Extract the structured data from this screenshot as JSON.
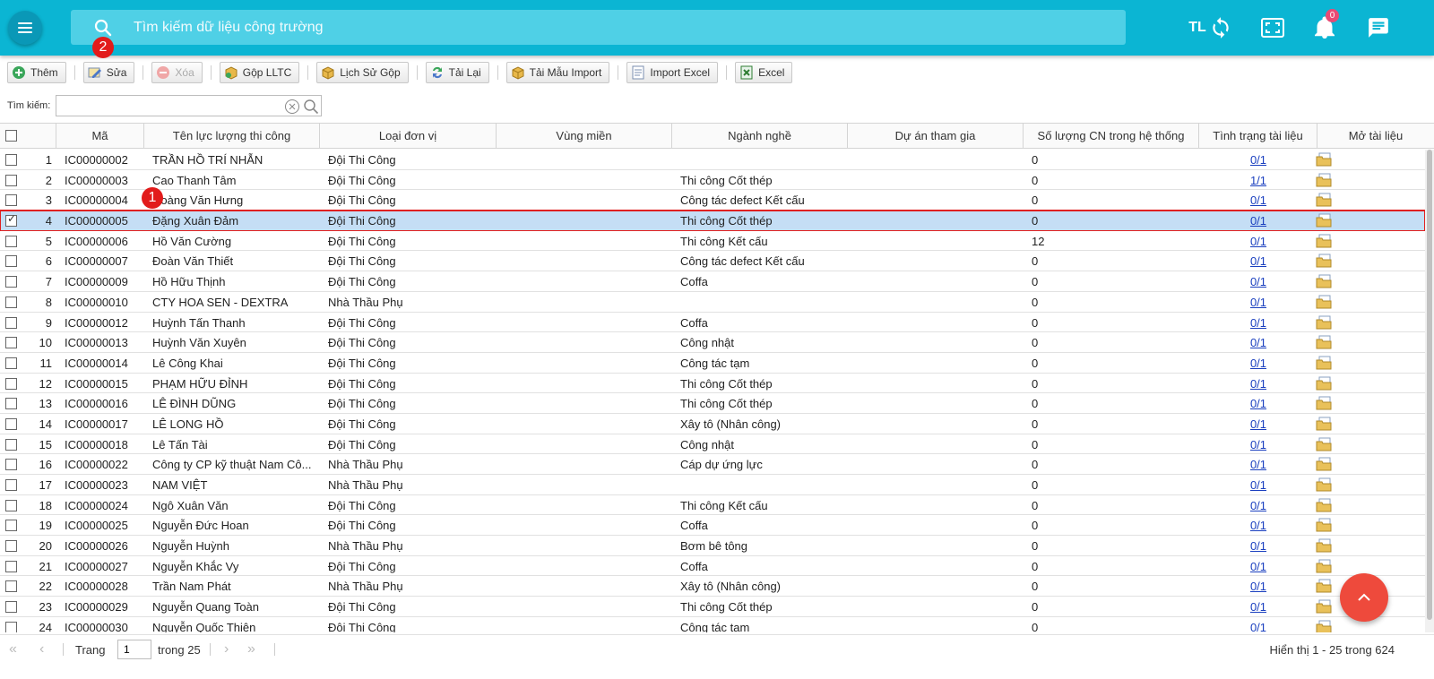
{
  "header": {
    "search_placeholder": "Tìm kiếm dữ liệu công trường",
    "user_initials": "TL",
    "notification_count": "0"
  },
  "toolbar": {
    "add": "Thêm",
    "edit": "Sửa",
    "delete": "Xóa",
    "merge": "Gộp LLTC",
    "merge_history": "Lịch Sử Gộp",
    "reload": "Tải Lại",
    "download_template": "Tải Mẫu Import",
    "import_excel": "Import Excel",
    "excel": "Excel"
  },
  "filter": {
    "label": "Tìm kiếm:",
    "value": ""
  },
  "grid": {
    "columns": [
      "Mã",
      "Tên lực lượng thi công",
      "Loại đơn vị",
      "Vùng miền",
      "Ngành nghề",
      "Dự án tham gia",
      "Số lượng CN trong hệ thống",
      "Tình trạng tài liệu",
      "Mở tài liệu"
    ],
    "rows": [
      {
        "n": "1",
        "code": "IC00000002",
        "name": "TRẦN HỒ TRÍ NHẪN",
        "unit": "Đội Thi Công",
        "region": "",
        "trade": "",
        "project": "",
        "qty": "0",
        "doc": "0/1"
      },
      {
        "n": "2",
        "code": "IC00000003",
        "name": "Cao Thanh Tâm",
        "unit": "Đội Thi Công",
        "region": "",
        "trade": "Thi công Cốt thép",
        "project": "",
        "qty": "0",
        "doc": "1/1"
      },
      {
        "n": "3",
        "code": "IC00000004",
        "name": "Hoàng Văn Hưng",
        "unit": "Đội Thi Công",
        "region": "",
        "trade": "Công tác defect Kết cấu",
        "project": "",
        "qty": "0",
        "doc": "0/1"
      },
      {
        "n": "4",
        "code": "IC00000005",
        "name": "Đặng Xuân Đảm",
        "unit": "Đội Thi Công",
        "region": "",
        "trade": "Thi công Cốt thép",
        "project": "",
        "qty": "0",
        "doc": "0/1"
      },
      {
        "n": "5",
        "code": "IC00000006",
        "name": "Hồ Văn Cường",
        "unit": "Đội Thi Công",
        "region": "",
        "trade": "Thi công Kết cấu",
        "project": "",
        "qty": "12",
        "doc": "0/1"
      },
      {
        "n": "6",
        "code": "IC00000007",
        "name": "Đoàn Văn Thiết",
        "unit": "Đội Thi Công",
        "region": "",
        "trade": "Công tác defect Kết cấu",
        "project": "",
        "qty": "0",
        "doc": "0/1"
      },
      {
        "n": "7",
        "code": "IC00000009",
        "name": "Hồ Hữu Thịnh",
        "unit": "Đội Thi Công",
        "region": "",
        "trade": "Coffa",
        "project": "",
        "qty": "0",
        "doc": "0/1"
      },
      {
        "n": "8",
        "code": "IC00000010",
        "name": "CTY HOA SEN - DEXTRA",
        "unit": "Nhà Thầu Phụ",
        "region": "",
        "trade": "",
        "project": "",
        "qty": "0",
        "doc": "0/1"
      },
      {
        "n": "9",
        "code": "IC00000012",
        "name": "Huỳnh Tấn Thanh",
        "unit": "Đội Thi Công",
        "region": "",
        "trade": "Coffa",
        "project": "",
        "qty": "0",
        "doc": "0/1"
      },
      {
        "n": "10",
        "code": "IC00000013",
        "name": "Huỳnh Văn Xuyên",
        "unit": "Đội Thi Công",
        "region": "",
        "trade": "Công nhật",
        "project": "",
        "qty": "0",
        "doc": "0/1"
      },
      {
        "n": "11",
        "code": "IC00000014",
        "name": "Lê Công Khai",
        "unit": "Đội Thi Công",
        "region": "",
        "trade": "Công tác tạm",
        "project": "",
        "qty": "0",
        "doc": "0/1"
      },
      {
        "n": "12",
        "code": "IC00000015",
        "name": "PHẠM HỮU ĐỈNH",
        "unit": "Đội Thi Công",
        "region": "",
        "trade": "Thi công Cốt thép",
        "project": "",
        "qty": "0",
        "doc": "0/1"
      },
      {
        "n": "13",
        "code": "IC00000016",
        "name": "LÊ ĐÌNH DŨNG",
        "unit": "Đội Thi Công",
        "region": "",
        "trade": "Thi công Cốt thép",
        "project": "",
        "qty": "0",
        "doc": "0/1"
      },
      {
        "n": "14",
        "code": "IC00000017",
        "name": "LÊ LONG HỒ",
        "unit": "Đội Thi Công",
        "region": "",
        "trade": "Xây tô (Nhân công)",
        "project": "",
        "qty": "0",
        "doc": "0/1"
      },
      {
        "n": "15",
        "code": "IC00000018",
        "name": "Lê Tấn Tài",
        "unit": "Đội Thi Công",
        "region": "",
        "trade": "Công nhật",
        "project": "",
        "qty": "0",
        "doc": "0/1"
      },
      {
        "n": "16",
        "code": "IC00000022",
        "name": "Công ty CP kỹ thuật Nam Cô...",
        "unit": "Nhà Thầu Phụ",
        "region": "",
        "trade": "Cáp dự ứng lực",
        "project": "",
        "qty": "0",
        "doc": "0/1"
      },
      {
        "n": "17",
        "code": "IC00000023",
        "name": "NAM VIỆT",
        "unit": "Nhà Thầu Phụ",
        "region": "",
        "trade": "",
        "project": "",
        "qty": "0",
        "doc": "0/1"
      },
      {
        "n": "18",
        "code": "IC00000024",
        "name": "Ngô Xuân Văn",
        "unit": "Đội Thi Công",
        "region": "",
        "trade": "Thi công Kết cấu",
        "project": "",
        "qty": "0",
        "doc": "0/1"
      },
      {
        "n": "19",
        "code": "IC00000025",
        "name": "Nguyễn Đức Hoan",
        "unit": "Đội Thi Công",
        "region": "",
        "trade": "Coffa",
        "project": "",
        "qty": "0",
        "doc": "0/1"
      },
      {
        "n": "20",
        "code": "IC00000026",
        "name": "Nguyễn Huỳnh",
        "unit": "Nhà Thầu Phụ",
        "region": "",
        "trade": "Bơm bê tông",
        "project": "",
        "qty": "0",
        "doc": "0/1"
      },
      {
        "n": "21",
        "code": "IC00000027",
        "name": "Nguyễn Khắc Vy",
        "unit": "Đội Thi Công",
        "region": "",
        "trade": "Coffa",
        "project": "",
        "qty": "0",
        "doc": "0/1"
      },
      {
        "n": "22",
        "code": "IC00000028",
        "name": "Trần Nam Phát",
        "unit": "Nhà Thầu Phụ",
        "region": "",
        "trade": "Xây tô (Nhân công)",
        "project": "",
        "qty": "0",
        "doc": "0/1"
      },
      {
        "n": "23",
        "code": "IC00000029",
        "name": "Nguyễn Quang Toàn",
        "unit": "Đội Thi Công",
        "region": "",
        "trade": "Thi công Cốt thép",
        "project": "",
        "qty": "0",
        "doc": "0/1"
      },
      {
        "n": "24",
        "code": "IC00000030",
        "name": "Nguyễn Quốc Thiện",
        "unit": "Đội Thi Công",
        "region": "",
        "trade": "Công tác tạm",
        "project": "",
        "qty": "0",
        "doc": "0/1"
      }
    ],
    "selected_row": 3
  },
  "pager": {
    "page_label": "Trang",
    "page_value": "1",
    "of_label": "trong 25",
    "summary": "Hiển thị 1 - 25 trong 624"
  },
  "markers": {
    "first": "1",
    "second": "2"
  },
  "colors": {
    "header": "#0bb5d3",
    "selection": "#c5def5",
    "highlight": "#e02020",
    "fab": "#ee4a3c"
  },
  "icons": {
    "menu": "hamburger-icon",
    "search": "search-icon",
    "sync": "sync-icon",
    "fullscreen": "fullscreen-icon",
    "bell": "bell-icon",
    "chat": "chat-icon",
    "scroll_top": "chevron-up-icon",
    "open_doc": "folder-doc-icon"
  }
}
